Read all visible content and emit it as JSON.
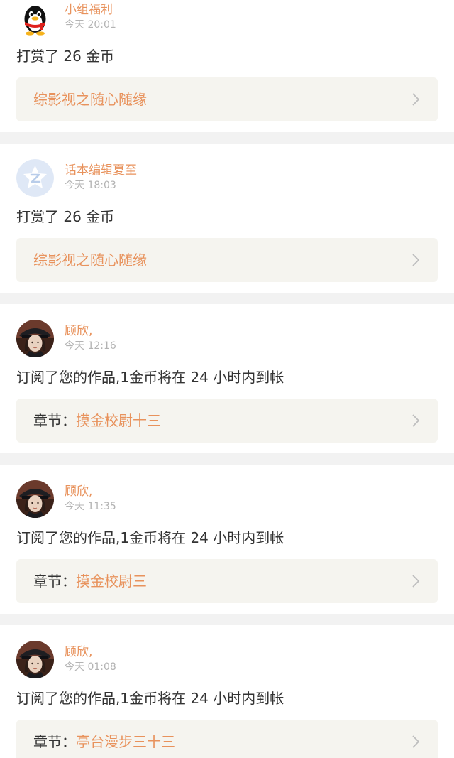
{
  "colors": {
    "accent": "#e8925c",
    "text": "#333333",
    "muted": "#b3b3b3",
    "link_bg": "#f5f4ef",
    "separator": "#f2f2f2"
  },
  "notifications": [
    {
      "avatar": "qq-penguin-icon",
      "username": "小组福利",
      "time": "今天 20:01",
      "message": "打赏了 26 金币",
      "link_prefix": "",
      "link_title": "综影视之随心随缘"
    },
    {
      "avatar": "star-badge-icon",
      "username": "话本编辑夏至",
      "time": "今天 18:03",
      "message": "打赏了 26 金币",
      "link_prefix": "",
      "link_title": "综影视之随心随缘"
    },
    {
      "avatar": "officer-portrait",
      "username": "顾欣,",
      "time": "今天 12:16",
      "message": "订阅了您的作品,1金币将在 24 小时内到帐",
      "link_prefix": "章节：",
      "link_title": "摸金校尉十三"
    },
    {
      "avatar": "officer-portrait",
      "username": "顾欣,",
      "time": "今天 11:35",
      "message": "订阅了您的作品,1金币将在 24 小时内到帐",
      "link_prefix": "章节：",
      "link_title": "摸金校尉三"
    },
    {
      "avatar": "officer-portrait",
      "username": "顾欣,",
      "time": "今天 01:08",
      "message": "订阅了您的作品,1金币将在 24 小时内到帐",
      "link_prefix": "章节：",
      "link_title": "亭台漫步三十三"
    }
  ]
}
